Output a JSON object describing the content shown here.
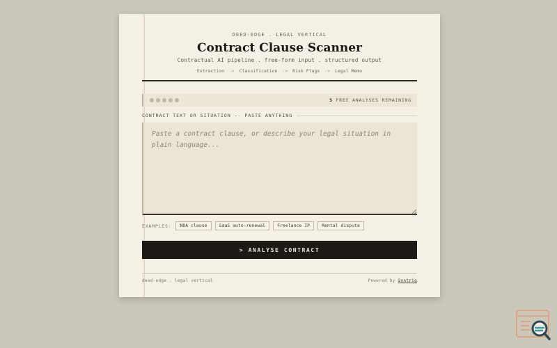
{
  "header": {
    "eyebrow": "DEED-EDGE . LEGAL VERTICAL",
    "title": "Contract Clause Scanner",
    "subtitle": "Contractual AI pipeline . free-form input . structured output",
    "pipeline": [
      "Extraction",
      "Classification",
      "Risk Flags",
      "Legal Memo"
    ],
    "pipeline_separator": "->"
  },
  "status": {
    "count": "5",
    "remaining_label": "FREE ANALYSES REMAINING",
    "dots": 5
  },
  "input": {
    "label": "CONTRACT TEXT OR SITUATION -- PASTE ANYTHING",
    "placeholder": "Paste a contract clause, or describe your legal situation in plain language...",
    "value": ""
  },
  "examples": {
    "label": "EXAMPLES:",
    "chips": [
      "NDA clause",
      "SaaS auto-renewal",
      "Freelance IP",
      "Rental dispute"
    ]
  },
  "action": {
    "analyse_label": "> ANALYSE CONTRACT"
  },
  "footer": {
    "left": "deed-edge . legal vertical",
    "powered_prefix": "Powered by",
    "powered_link": "Syntrig"
  },
  "colors": {
    "background": "#cac7bb",
    "card": "#f5f0e6",
    "ink": "#1d1915",
    "accent": "#d9805a"
  }
}
